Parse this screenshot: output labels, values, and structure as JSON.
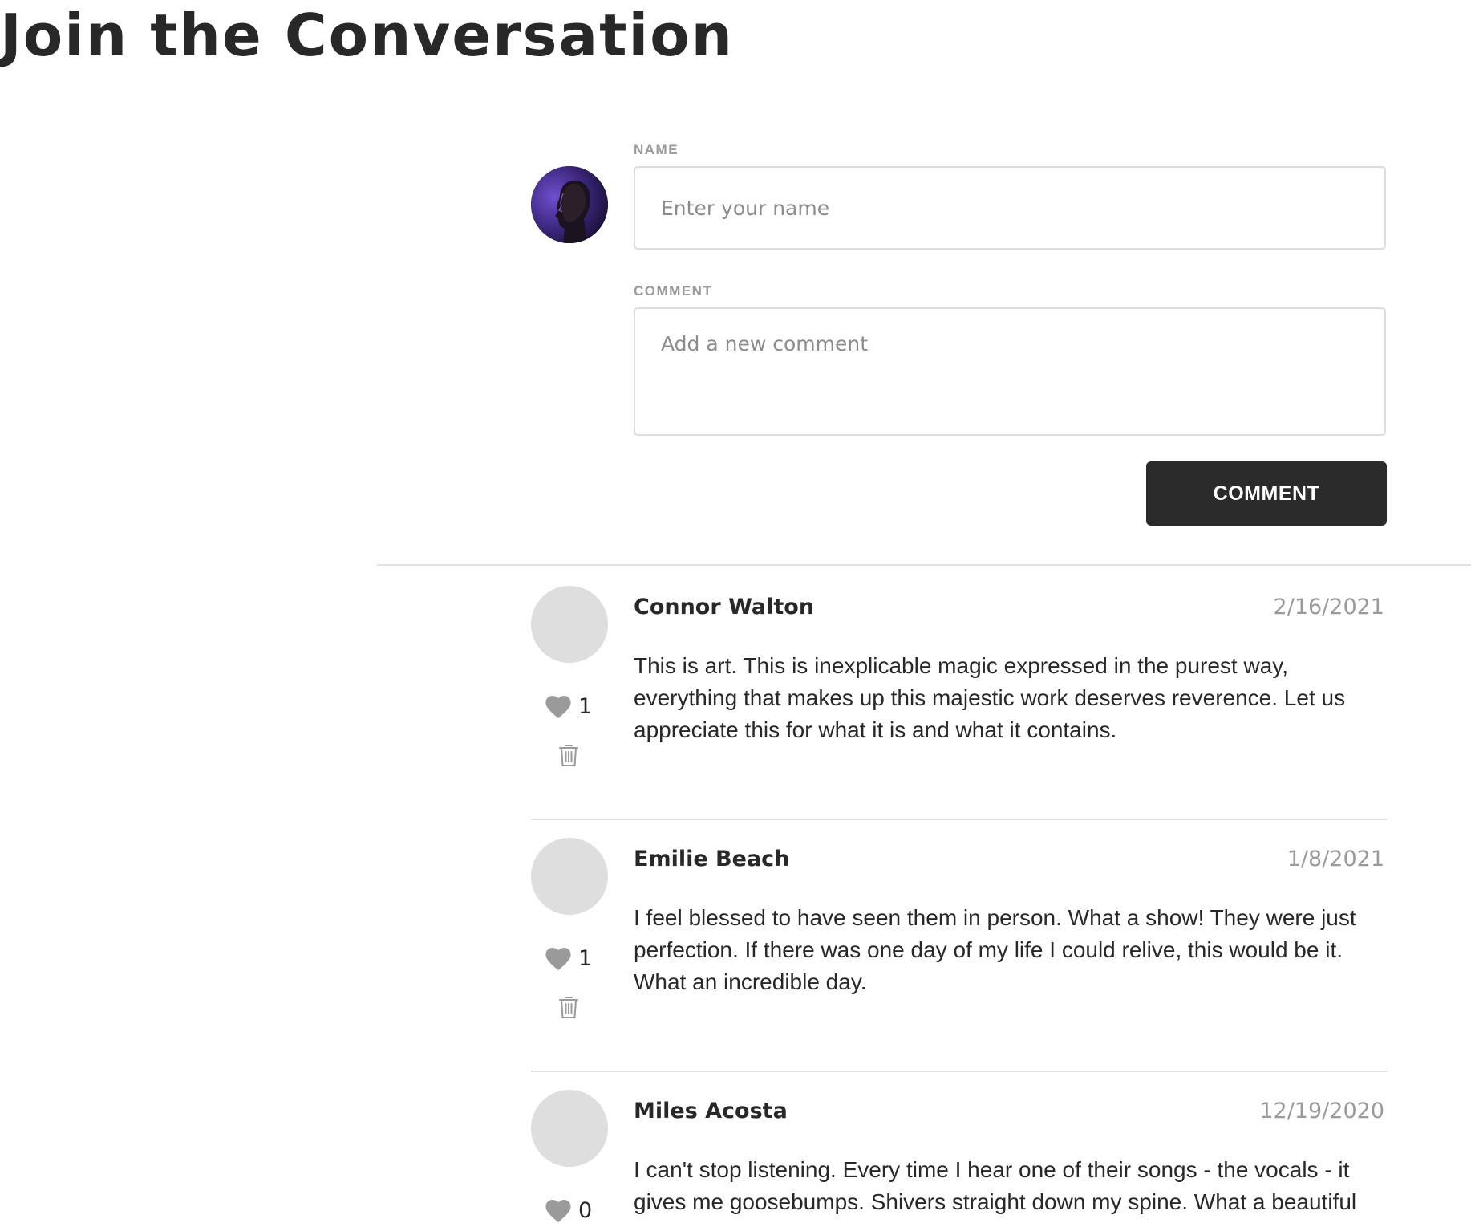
{
  "page": {
    "title": "Join the Conversation"
  },
  "form": {
    "name_label": "NAME",
    "name_placeholder": "Enter your name",
    "name_value": "",
    "comment_label": "COMMENT",
    "comment_placeholder": "Add a new comment",
    "comment_value": "",
    "submit_label": "COMMENT",
    "avatar_icon": "user-portrait"
  },
  "icons": {
    "like": "heart-icon",
    "delete": "trash-icon"
  },
  "colors": {
    "button_bg": "#2b2b2b",
    "text": "#282828",
    "muted": "#9a9a9a",
    "placeholder_avatar": "#dedede",
    "icon": "#9a9a9a"
  },
  "comments": [
    {
      "author": "Connor Walton",
      "date": "2/16/2021",
      "likes": "1",
      "text": "This is art. This is inexplicable magic expressed in the purest way, everything that makes up this majestic work deserves reverence. Let us appreciate this for what it is and what it contains."
    },
    {
      "author": "Emilie Beach",
      "date": "1/8/2021",
      "likes": "1",
      "text": "I feel blessed to have seen them in person. What a show! They were just perfection. If there was one day of my life I could relive, this would be it. What an incredible day."
    },
    {
      "author": "Miles Acosta",
      "date": "12/19/2020",
      "likes": "0",
      "text": "I can't stop listening. Every time I hear one of their songs - the vocals - it gives me goosebumps. Shivers straight down my spine. What a beautiful"
    }
  ]
}
